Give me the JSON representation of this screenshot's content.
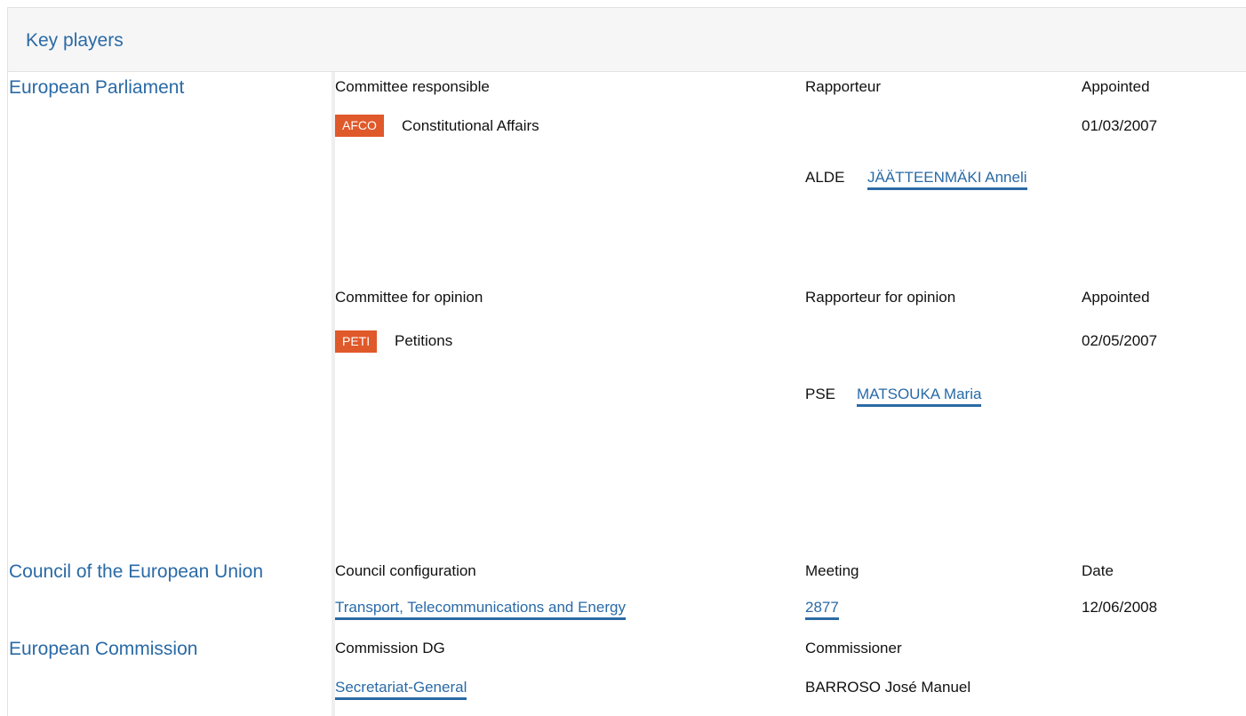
{
  "header": {
    "title": "Key players"
  },
  "institutions": {
    "parliament": "European Parliament",
    "council": "Council of the European Union",
    "commission": "European Commission"
  },
  "parliament": {
    "responsible": {
      "col_committee": "Committee responsible",
      "col_rapporteur": "Rapporteur",
      "col_appointed": "Appointed",
      "badge": "AFCO",
      "committee": "Constitutional Affairs",
      "date": "01/03/2007",
      "group": "ALDE",
      "rapporteur": "JÄÄTTEENMÄKI Anneli"
    },
    "opinion": {
      "col_committee": "Committee for opinion",
      "col_rapporteur": "Rapporteur for opinion",
      "col_appointed": "Appointed",
      "badge": "PETI",
      "committee": "Petitions",
      "date": "02/05/2007",
      "group": "PSE",
      "rapporteur": "MATSOUKA Maria"
    }
  },
  "council": {
    "col_configuration": "Council configuration",
    "col_meeting": "Meeting",
    "col_date": "Date",
    "configuration": "Transport, Telecommunications and Energy",
    "meeting": "2877",
    "date": "12/06/2008"
  },
  "commission": {
    "col_dg": "Commission DG",
    "col_commissioner": "Commissioner",
    "dg": "Secretariat-General",
    "commissioner": "BARROSO José Manuel"
  },
  "colors": {
    "link": "#2a6aa6",
    "badge": "#e0592a",
    "header_bg": "#f6f6f6"
  }
}
